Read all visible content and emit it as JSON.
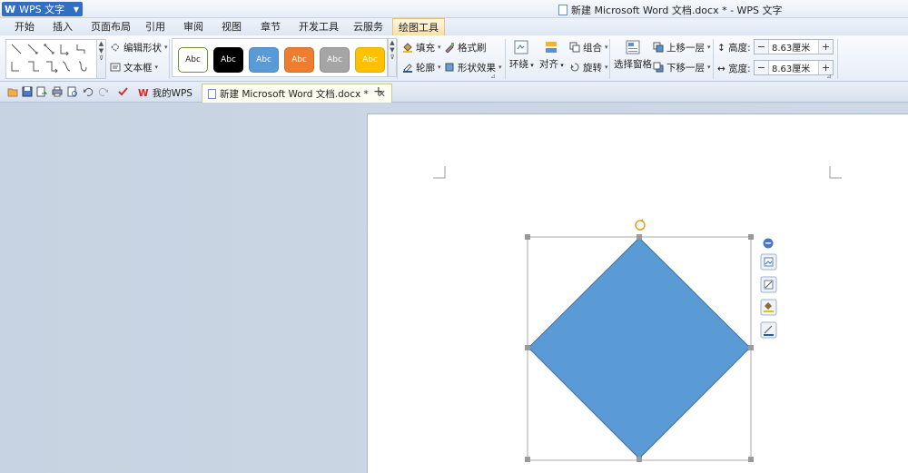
{
  "app": {
    "name": "WPS 文字",
    "window_title": "新建 Microsoft Word 文档.docx * - WPS 文字"
  },
  "menu": {
    "tabs": [
      {
        "label": "开始"
      },
      {
        "label": "插入"
      },
      {
        "label": "页面布局"
      },
      {
        "label": "引用"
      },
      {
        "label": "审阅"
      },
      {
        "label": "视图"
      },
      {
        "label": "章节"
      },
      {
        "label": "开发工具"
      },
      {
        "label": "云服务"
      },
      {
        "label": "绘图工具"
      }
    ],
    "active": "绘图工具"
  },
  "ribbon": {
    "edit_shape": "编辑形状",
    "text_box": "文本框",
    "styles": [
      {
        "label": "Abc",
        "fill": "#ffffff",
        "border": "#6e8f3a",
        "text": "#222222"
      },
      {
        "label": "Abc",
        "fill": "#000000",
        "border": "#000000",
        "text": "#ffffff"
      },
      {
        "label": "Abc",
        "fill": "#5b9bd5",
        "border": "#4a86c0",
        "text": "#ffffff"
      },
      {
        "label": "Abc",
        "fill": "#ed7d31",
        "border": "#d06b25",
        "text": "#ffffff"
      },
      {
        "label": "Abc",
        "fill": "#a5a5a5",
        "border": "#8d8d8d",
        "text": "#ffffff"
      },
      {
        "label": "Abc",
        "fill": "#ffc000",
        "border": "#e0a800",
        "text": "#ffffff"
      }
    ],
    "fill": "填充",
    "format_painter": "格式刷",
    "outline": "轮廓",
    "shape_effects": "形状效果",
    "wrap": "环绕",
    "align": "对齐",
    "group": "组合",
    "rotate": "旋转",
    "selection_pane": "选择窗格",
    "bring_forward": "上移一层",
    "send_backward": "下移一层",
    "height_label": "高度:",
    "height_value": "8.63厘米",
    "width_label": "宽度:",
    "width_value": "8.63厘米"
  },
  "tabs": {
    "home": "我的WPS",
    "document": "新建 Microsoft Word 文档.docx *"
  },
  "shape": {
    "type": "diamond",
    "fill": "#5b9bd5",
    "stroke": "#41719c"
  },
  "colors": {
    "accent": "#2f6fc6",
    "active_tab": "#f7e1a8"
  }
}
